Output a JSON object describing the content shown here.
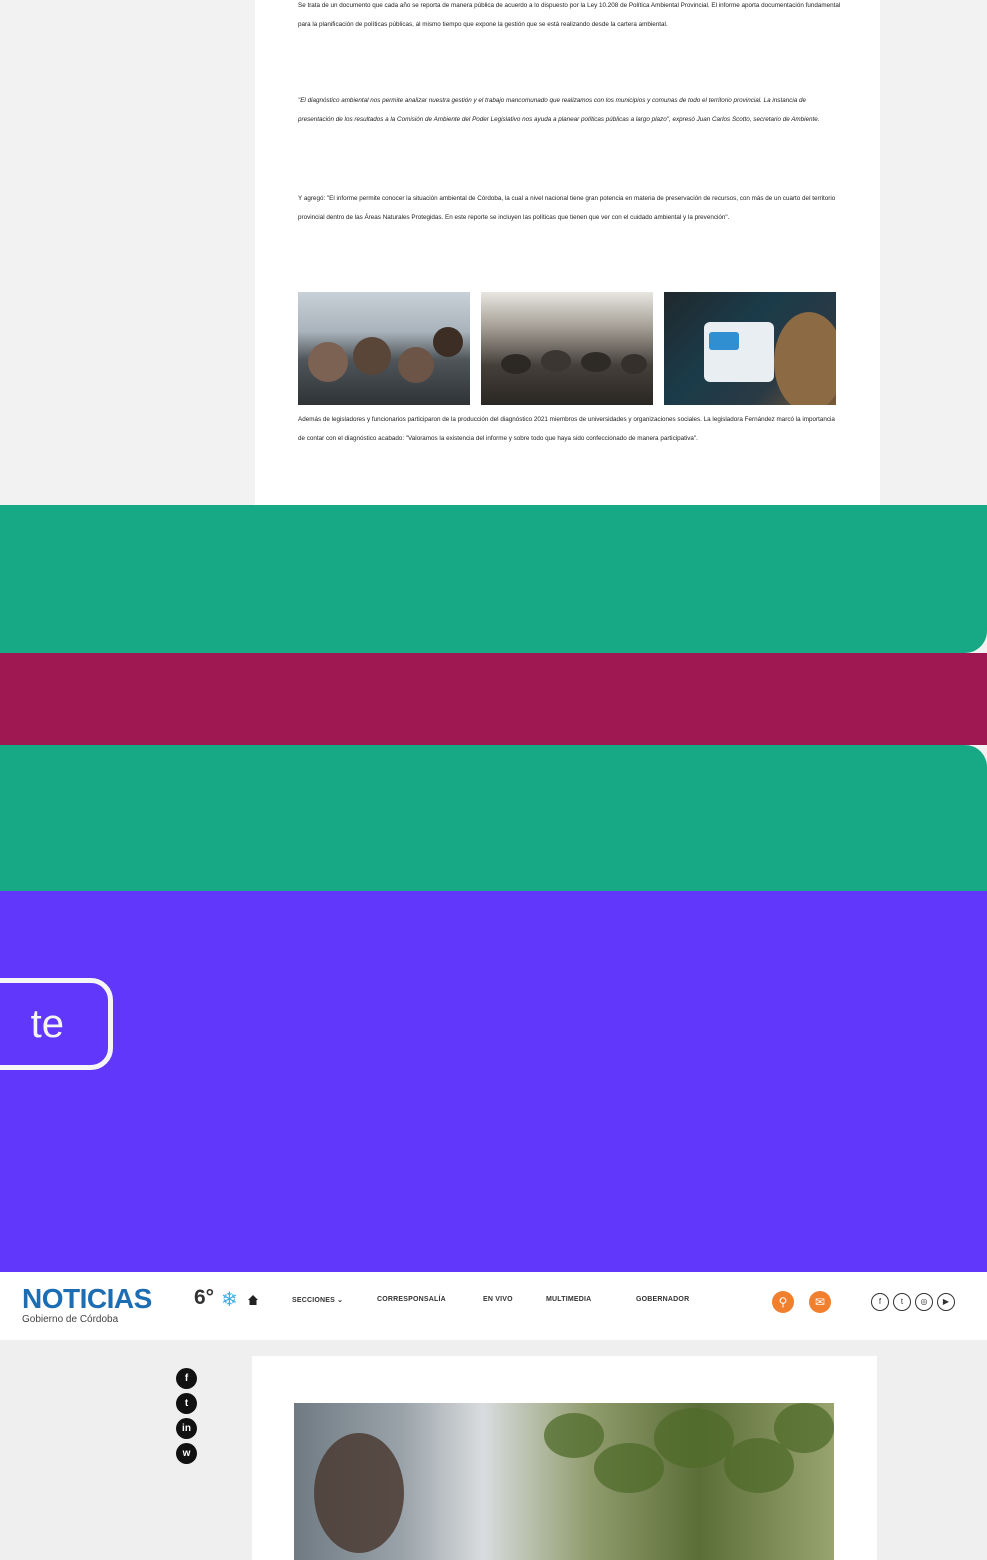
{
  "article": {
    "paragraphs": [
      "Se trata de un documento que cada año se reporta de manera pública de acuerdo a lo dispuesto por la Ley 10.208 de Política Ambiental Provincial. El informe aporta documentación fundamental para la planificación de políticas públicas, al mismo tiempo que expone la gestión que se está realizando desde la cartera ambiental.",
      "\"El diagnóstico ambiental nos permite analizar nuestra gestión y el trabajo mancomunado que realizamos con los municipios y comunas de todo el territorio provincial. La instancia de presentación de los resultados a la Comisión de Ambiente del Poder Legislativo nos ayuda a planear políticas públicas a largo plazo\", expresó Juan Carlos Scotto, secretario de Ambiente.",
      "Y agregó: \"El informe permite conocer la situación ambiental de Córdoba, la cual a nivel nacional tiene gran potencia en materia de preservación de recursos, con más de un cuarto del territorio provincial dentro de las Áreas Naturales Protegidas. En este reporte se incluyen las políticas que tienen que ver con el cuidado ambiental y la prevención\".",
      "Además de legisladores y funcionarios participaron de la producción del diagnóstico 2021 miembros de universidades y organizaciones sociales. La legisladora Fernández marcó la importancia de contar con el diagnóstico acabado: \"Valoramos la existencia del informe y sobre todo que haya sido confeccionado de manera participativa\"."
    ]
  },
  "overlay": {
    "button_label": "te"
  },
  "header": {
    "logo_title": "NOTICIAS",
    "logo_subtitle": "Gobierno de Córdoba",
    "temperature": "6°",
    "weather_icon": "❄",
    "nav_items": [
      "SECCIONES ⌄",
      "CORRESPONSALÍA",
      "EN VIVO",
      "MULTIMEDIA",
      "GOBERNADOR"
    ],
    "search_icon": "⚲",
    "mail_icon": "✉",
    "social": [
      "f",
      "t",
      "◎",
      "▶"
    ]
  },
  "share": {
    "icons": [
      "f",
      "t",
      "in",
      "w"
    ]
  },
  "colors": {
    "green": "#17a985",
    "magenta": "#9f1851",
    "purple": "#6138fb",
    "orange": "#f07f2e",
    "logo_blue": "#1c6db2"
  }
}
